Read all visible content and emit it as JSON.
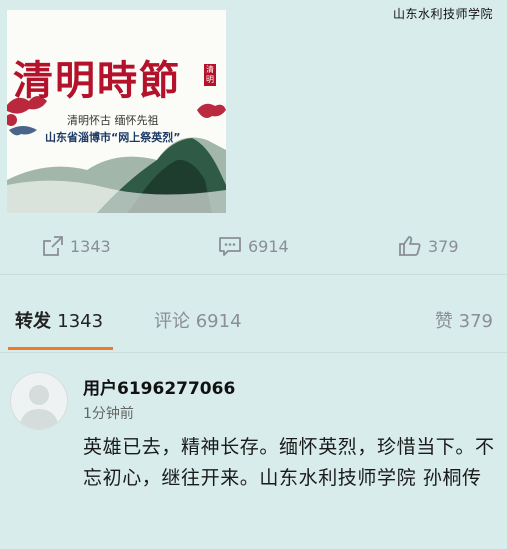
{
  "watermark": "山东水利技师学院",
  "poster": {
    "title": "清明時節",
    "subtitle": "清明怀古 缅怀先祖",
    "caption": "山东省淄博市“网上祭英烈”",
    "stamp": "清明"
  },
  "actions": {
    "repost_count": "1343",
    "comment_count": "6914",
    "like_count": "379"
  },
  "tabs": {
    "repost_label": "转发",
    "repost_count": "1343",
    "comment_label": "评论",
    "comment_count": "6914",
    "like_label": "赞",
    "like_count": "379"
  },
  "comment": {
    "username": "用户6196277066",
    "time": "1分钟前",
    "text": "英雄已去，精神长存。缅怀英烈，珍惜当下。不忘初心，继往开来。山东水利技师学院 孙桐传"
  },
  "colors": {
    "accent": "#f07a2a",
    "background": "#d8ecec",
    "poster_red": "#b3122a"
  }
}
